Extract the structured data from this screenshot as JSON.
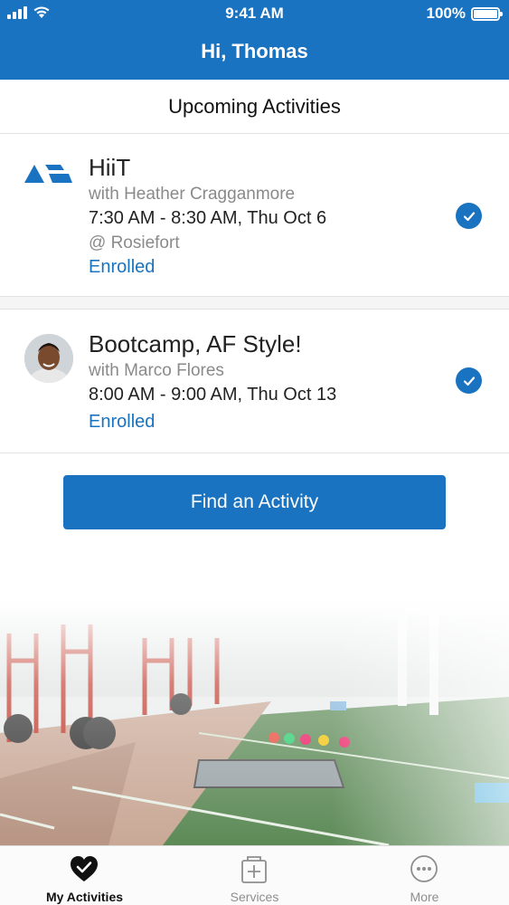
{
  "status_bar": {
    "time": "9:41 AM",
    "battery": "100%"
  },
  "header": {
    "greeting": "Hi, Thomas"
  },
  "section": {
    "title": "Upcoming Activities"
  },
  "activities": [
    {
      "title": "HiiT",
      "instructor": "with Heather Cragganmore",
      "time": "7:30 AM - 8:30 AM, Thu Oct 6",
      "location": "@ Rosiefort",
      "status": "Enrolled",
      "icon": "brand-logo-icon"
    },
    {
      "title": "Bootcamp, AF Style!",
      "instructor": "with Marco Flores",
      "time": "8:00 AM - 9:00 AM, Thu Oct 13",
      "status": "Enrolled",
      "icon": "instructor-avatar"
    }
  ],
  "actions": {
    "find_activity": "Find an Activity"
  },
  "tabbar": {
    "tabs": [
      {
        "label": "My Activities",
        "icon": "heart-check-icon",
        "active": true
      },
      {
        "label": "Services",
        "icon": "services-icon",
        "active": false
      },
      {
        "label": "More",
        "icon": "more-icon",
        "active": false
      }
    ]
  },
  "colors": {
    "brand": "#1a73c0",
    "enrolled": "#1a73c0",
    "muted": "#8a8a8a"
  }
}
